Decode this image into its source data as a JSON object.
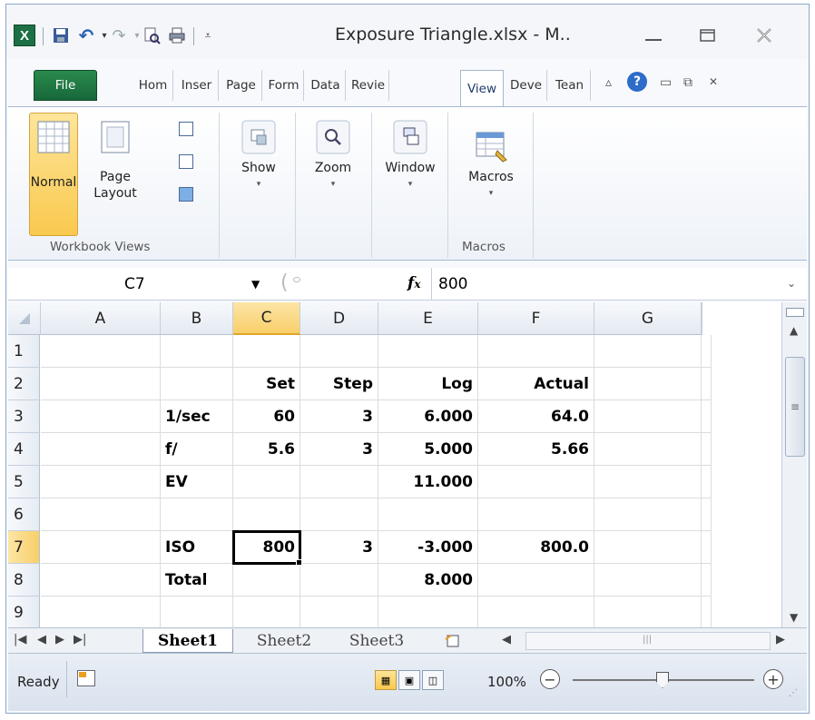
{
  "window": {
    "title": "Exposure Triangle.xlsx - M.."
  },
  "icons": {
    "excel": "excel-logo-icon",
    "save": "save-icon",
    "undo": "undo-icon",
    "redo": "redo-icon",
    "print_preview": "print-preview-icon",
    "print": "print-icon",
    "customize": "customize-qat-icon"
  },
  "tabs": [
    "File",
    "Hom",
    "Inser",
    "Page",
    "Form",
    "Data",
    "Revie",
    "View",
    "Deve",
    "Tean"
  ],
  "active_tab": "View",
  "ribbon": {
    "normal": "Normal",
    "page_layout_1": "Page",
    "page_layout_2": "Layout",
    "group_workbook_views": "Workbook Views",
    "show": "Show",
    "zoom": "Zoom",
    "window": "Window",
    "macros": "Macros",
    "group_macros": "Macros"
  },
  "formula_bar": {
    "name_box": "C7",
    "fx": "fx",
    "value": "800"
  },
  "columns": [
    "A",
    "B",
    "C",
    "D",
    "E",
    "F",
    "G"
  ],
  "selected_cell": "C7",
  "rows": [
    {
      "num": "1",
      "A": "",
      "B": "",
      "C": "",
      "D": "",
      "E": "",
      "F": ""
    },
    {
      "num": "2",
      "A": "",
      "B": "",
      "C": "Set",
      "D": "Step",
      "E": "Log",
      "F": "Actual"
    },
    {
      "num": "3",
      "A": "",
      "B": "1/sec",
      "C": "60",
      "D": "3",
      "E": "6.000",
      "F": "64.0"
    },
    {
      "num": "4",
      "A": "",
      "B": "f/",
      "C": "5.6",
      "D": "3",
      "E": "5.000",
      "F": "5.66"
    },
    {
      "num": "5",
      "A": "",
      "B": "EV",
      "C": "",
      "D": "",
      "E": "11.000",
      "F": ""
    },
    {
      "num": "6",
      "A": "",
      "B": "",
      "C": "",
      "D": "",
      "E": "",
      "F": ""
    },
    {
      "num": "7",
      "A": "",
      "B": "ISO",
      "C": "800",
      "D": "3",
      "E": "-3.000",
      "F": "800.0"
    },
    {
      "num": "8",
      "A": "",
      "B": "Total",
      "C": "",
      "D": "",
      "E": "8.000",
      "F": ""
    },
    {
      "num": "9",
      "A": "",
      "B": "",
      "C": "",
      "D": "",
      "E": "",
      "F": ""
    }
  ],
  "sheets": [
    "Sheet1",
    "Sheet2",
    "Sheet3"
  ],
  "active_sheet": "Sheet1",
  "status": {
    "ready": "Ready",
    "zoom": "100%"
  }
}
